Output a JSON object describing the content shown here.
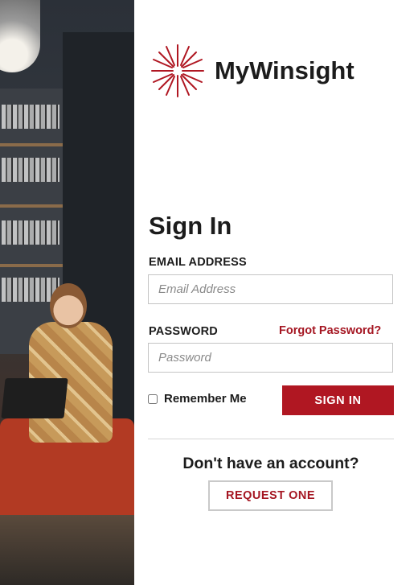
{
  "brand": {
    "name": "MyWinsight",
    "logo_icon": "starburst-icon",
    "accent_color": "#b01722"
  },
  "form": {
    "title": "Sign In",
    "email": {
      "label": "EMAIL ADDRESS",
      "placeholder": "Email Address",
      "value": ""
    },
    "password": {
      "label": "PASSWORD",
      "placeholder": "Password",
      "value": ""
    },
    "forgot_password_link": "Forgot Password?",
    "remember_me_label": "Remember Me",
    "remember_me_checked": false,
    "sign_in_button": "SIGN IN"
  },
  "signup": {
    "prompt": "Don't have an account?",
    "request_button": "REQUEST ONE"
  }
}
